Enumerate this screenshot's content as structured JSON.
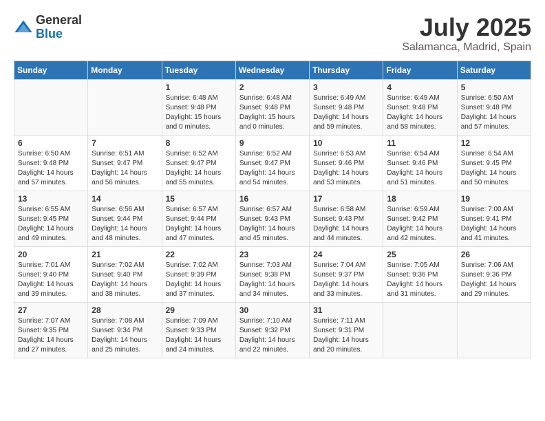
{
  "header": {
    "logo_general": "General",
    "logo_blue": "Blue",
    "month_title": "July 2025",
    "location": "Salamanca, Madrid, Spain"
  },
  "weekdays": [
    "Sunday",
    "Monday",
    "Tuesday",
    "Wednesday",
    "Thursday",
    "Friday",
    "Saturday"
  ],
  "weeks": [
    [
      {
        "day": "",
        "content": ""
      },
      {
        "day": "",
        "content": ""
      },
      {
        "day": "1",
        "content": "Sunrise: 6:48 AM\nSunset: 9:48 PM\nDaylight: 15 hours\nand 0 minutes."
      },
      {
        "day": "2",
        "content": "Sunrise: 6:48 AM\nSunset: 9:48 PM\nDaylight: 15 hours\nand 0 minutes."
      },
      {
        "day": "3",
        "content": "Sunrise: 6:49 AM\nSunset: 9:48 PM\nDaylight: 14 hours\nand 59 minutes."
      },
      {
        "day": "4",
        "content": "Sunrise: 6:49 AM\nSunset: 9:48 PM\nDaylight: 14 hours\nand 58 minutes."
      },
      {
        "day": "5",
        "content": "Sunrise: 6:50 AM\nSunset: 9:48 PM\nDaylight: 14 hours\nand 57 minutes."
      }
    ],
    [
      {
        "day": "6",
        "content": "Sunrise: 6:50 AM\nSunset: 9:48 PM\nDaylight: 14 hours\nand 57 minutes."
      },
      {
        "day": "7",
        "content": "Sunrise: 6:51 AM\nSunset: 9:47 PM\nDaylight: 14 hours\nand 56 minutes."
      },
      {
        "day": "8",
        "content": "Sunrise: 6:52 AM\nSunset: 9:47 PM\nDaylight: 14 hours\nand 55 minutes."
      },
      {
        "day": "9",
        "content": "Sunrise: 6:52 AM\nSunset: 9:47 PM\nDaylight: 14 hours\nand 54 minutes."
      },
      {
        "day": "10",
        "content": "Sunrise: 6:53 AM\nSunset: 9:46 PM\nDaylight: 14 hours\nand 53 minutes."
      },
      {
        "day": "11",
        "content": "Sunrise: 6:54 AM\nSunset: 9:46 PM\nDaylight: 14 hours\nand 51 minutes."
      },
      {
        "day": "12",
        "content": "Sunrise: 6:54 AM\nSunset: 9:45 PM\nDaylight: 14 hours\nand 50 minutes."
      }
    ],
    [
      {
        "day": "13",
        "content": "Sunrise: 6:55 AM\nSunset: 9:45 PM\nDaylight: 14 hours\nand 49 minutes."
      },
      {
        "day": "14",
        "content": "Sunrise: 6:56 AM\nSunset: 9:44 PM\nDaylight: 14 hours\nand 48 minutes."
      },
      {
        "day": "15",
        "content": "Sunrise: 6:57 AM\nSunset: 9:44 PM\nDaylight: 14 hours\nand 47 minutes."
      },
      {
        "day": "16",
        "content": "Sunrise: 6:57 AM\nSunset: 9:43 PM\nDaylight: 14 hours\nand 45 minutes."
      },
      {
        "day": "17",
        "content": "Sunrise: 6:58 AM\nSunset: 9:43 PM\nDaylight: 14 hours\nand 44 minutes."
      },
      {
        "day": "18",
        "content": "Sunrise: 6:59 AM\nSunset: 9:42 PM\nDaylight: 14 hours\nand 42 minutes."
      },
      {
        "day": "19",
        "content": "Sunrise: 7:00 AM\nSunset: 9:41 PM\nDaylight: 14 hours\nand 41 minutes."
      }
    ],
    [
      {
        "day": "20",
        "content": "Sunrise: 7:01 AM\nSunset: 9:40 PM\nDaylight: 14 hours\nand 39 minutes."
      },
      {
        "day": "21",
        "content": "Sunrise: 7:02 AM\nSunset: 9:40 PM\nDaylight: 14 hours\nand 38 minutes."
      },
      {
        "day": "22",
        "content": "Sunrise: 7:02 AM\nSunset: 9:39 PM\nDaylight: 14 hours\nand 37 minutes."
      },
      {
        "day": "23",
        "content": "Sunrise: 7:03 AM\nSunset: 9:38 PM\nDaylight: 14 hours\nand 34 minutes."
      },
      {
        "day": "24",
        "content": "Sunrise: 7:04 AM\nSunset: 9:37 PM\nDaylight: 14 hours\nand 33 minutes."
      },
      {
        "day": "25",
        "content": "Sunrise: 7:05 AM\nSunset: 9:36 PM\nDaylight: 14 hours\nand 31 minutes."
      },
      {
        "day": "26",
        "content": "Sunrise: 7:06 AM\nSunset: 9:36 PM\nDaylight: 14 hours\nand 29 minutes."
      }
    ],
    [
      {
        "day": "27",
        "content": "Sunrise: 7:07 AM\nSunset: 9:35 PM\nDaylight: 14 hours\nand 27 minutes."
      },
      {
        "day": "28",
        "content": "Sunrise: 7:08 AM\nSunset: 9:34 PM\nDaylight: 14 hours\nand 25 minutes."
      },
      {
        "day": "29",
        "content": "Sunrise: 7:09 AM\nSunset: 9:33 PM\nDaylight: 14 hours\nand 24 minutes."
      },
      {
        "day": "30",
        "content": "Sunrise: 7:10 AM\nSunset: 9:32 PM\nDaylight: 14 hours\nand 22 minutes."
      },
      {
        "day": "31",
        "content": "Sunrise: 7:11 AM\nSunset: 9:31 PM\nDaylight: 14 hours\nand 20 minutes."
      },
      {
        "day": "",
        "content": ""
      },
      {
        "day": "",
        "content": ""
      }
    ]
  ]
}
